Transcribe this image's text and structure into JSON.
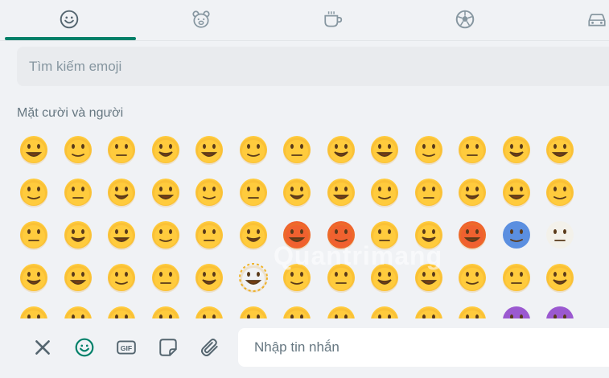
{
  "tabs": [
    {
      "icon": "smiley-icon",
      "active": true
    },
    {
      "icon": "bear-icon",
      "active": false
    },
    {
      "icon": "cup-icon",
      "active": false
    },
    {
      "icon": "ball-icon",
      "active": false
    },
    {
      "icon": "car-icon",
      "active": false
    }
  ],
  "search": {
    "placeholder": "Tìm kiếm emoji"
  },
  "section": {
    "title": "Mặt cười và người"
  },
  "watermark": "Quantrimang",
  "emoji_rows": [
    [
      "grinning-face",
      "grinning-big-eyes",
      "grinning-smiling-eyes",
      "beaming-face",
      "squinting-laugh",
      "face-holding-tears",
      "grinning-sweat",
      "tears-of-joy",
      "rolling-laughing",
      "face-holding-tears-2",
      "smiling-face",
      "smiling-blush",
      "halo-face"
    ],
    [
      "yum-face",
      "tongue-face",
      "squinting-tongue",
      "winking-tongue",
      "zany-face",
      "raised-eyebrow",
      "monocle-face",
      "nerd-face",
      "sunglasses-face",
      "disguised-face",
      "star-struck",
      "partying-face",
      "smirking-face"
    ],
    [
      "tired-face",
      "pleading-face",
      "crying-face",
      "loudly-crying",
      "steam-nose",
      "angry-face",
      "pouting-face",
      "cursing-face",
      "exploding-head",
      "flushed-face",
      "hot-face",
      "cold-face",
      "fog-face"
    ],
    [
      "saluting-face",
      "hand-over-mouth",
      "melting-face",
      "lying-face",
      "no-mouth-face",
      "dotted-line-face",
      "neutral-face",
      "expressionless-face",
      "peeking-face",
      "grimacing-face",
      "rolling-eyes",
      "hushed-face",
      "sleepy-face"
    ],
    [
      "partial-1",
      "partial-2",
      "partial-3",
      "partial-4",
      "partial-5",
      "partial-6",
      "partial-7",
      "partial-8",
      "partial-9",
      "partial-10",
      "partial-11",
      "devil-face",
      "devil-face-2"
    ]
  ],
  "toolbar": {
    "close": "close-icon",
    "emoji": "emoji-icon",
    "gif": "GIF",
    "sticker": "sticker-icon",
    "attach": "attach-icon"
  },
  "message": {
    "placeholder": "Nhập tin nhắn"
  },
  "colors": {
    "accent": "#008069",
    "emoji": "#ffcb3d",
    "background": "#f0f2f5"
  }
}
